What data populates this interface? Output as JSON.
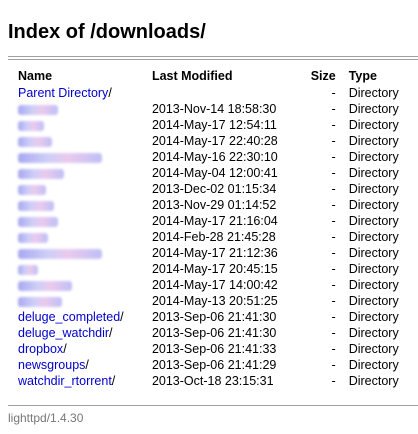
{
  "page": {
    "title": "Index of /downloads/",
    "footer": "lighttpd/1.4.30"
  },
  "table": {
    "headers": {
      "name": "Name",
      "modified": "Last Modified",
      "size": "Size",
      "type": "Type"
    },
    "rows": [
      {
        "name": "Parent Directory",
        "slash": "/",
        "modified": "",
        "size": "-",
        "type": "Directory",
        "redacted": false
      },
      {
        "name": "",
        "slash": "",
        "modified": "2013-Nov-14 18:58:30",
        "size": "-",
        "type": "Directory",
        "redacted": true
      },
      {
        "name": "",
        "slash": "",
        "modified": "2014-May-17 12:54:11",
        "size": "-",
        "type": "Directory",
        "redacted": true
      },
      {
        "name": "",
        "slash": "",
        "modified": "2014-May-17 22:40:28",
        "size": "-",
        "type": "Directory",
        "redacted": true
      },
      {
        "name": "",
        "slash": "",
        "modified": "2014-May-16 22:30:10",
        "size": "-",
        "type": "Directory",
        "redacted": true
      },
      {
        "name": "",
        "slash": "",
        "modified": "2014-May-04 12:00:41",
        "size": "-",
        "type": "Directory",
        "redacted": true
      },
      {
        "name": "",
        "slash": "",
        "modified": "2013-Dec-02 01:15:34",
        "size": "-",
        "type": "Directory",
        "redacted": true
      },
      {
        "name": "",
        "slash": "",
        "modified": "2013-Nov-29 01:14:52",
        "size": "-",
        "type": "Directory",
        "redacted": true
      },
      {
        "name": "",
        "slash": "",
        "modified": "2014-May-17 21:16:04",
        "size": "-",
        "type": "Directory",
        "redacted": true
      },
      {
        "name": "",
        "slash": "",
        "modified": "2014-Feb-28 21:45:28",
        "size": "-",
        "type": "Directory",
        "redacted": true
      },
      {
        "name": "",
        "slash": "",
        "modified": "2014-May-17 21:12:36",
        "size": "-",
        "type": "Directory",
        "redacted": true
      },
      {
        "name": "",
        "slash": "",
        "modified": "2014-May-17 20:45:15",
        "size": "-",
        "type": "Directory",
        "redacted": true
      },
      {
        "name": "",
        "slash": "",
        "modified": "2014-May-17 14:00:42",
        "size": "-",
        "type": "Directory",
        "redacted": true
      },
      {
        "name": "",
        "slash": "",
        "modified": "2014-May-13 20:51:25",
        "size": "-",
        "type": "Directory",
        "redacted": true
      },
      {
        "name": "deluge_completed",
        "slash": "/",
        "modified": "2013-Sep-06 21:41:30",
        "size": "-",
        "type": "Directory",
        "redacted": false
      },
      {
        "name": "deluge_watchdir",
        "slash": "/",
        "modified": "2013-Sep-06 21:41:30",
        "size": "-",
        "type": "Directory",
        "redacted": false
      },
      {
        "name": "dropbox",
        "slash": "/",
        "modified": "2013-Sep-06 21:41:33",
        "size": "-",
        "type": "Directory",
        "redacted": false
      },
      {
        "name": "newsgroups",
        "slash": "/",
        "modified": "2013-Sep-06 21:41:29",
        "size": "-",
        "type": "Directory",
        "redacted": false
      },
      {
        "name": "watchdir_rtorrent",
        "slash": "/",
        "modified": "2013-Oct-18 23:15:31",
        "size": "-",
        "type": "Directory",
        "redacted": false
      }
    ]
  },
  "colors": {
    "link": "#0000cc",
    "rule": "#a0a0a0",
    "footer_text": "#777777"
  }
}
